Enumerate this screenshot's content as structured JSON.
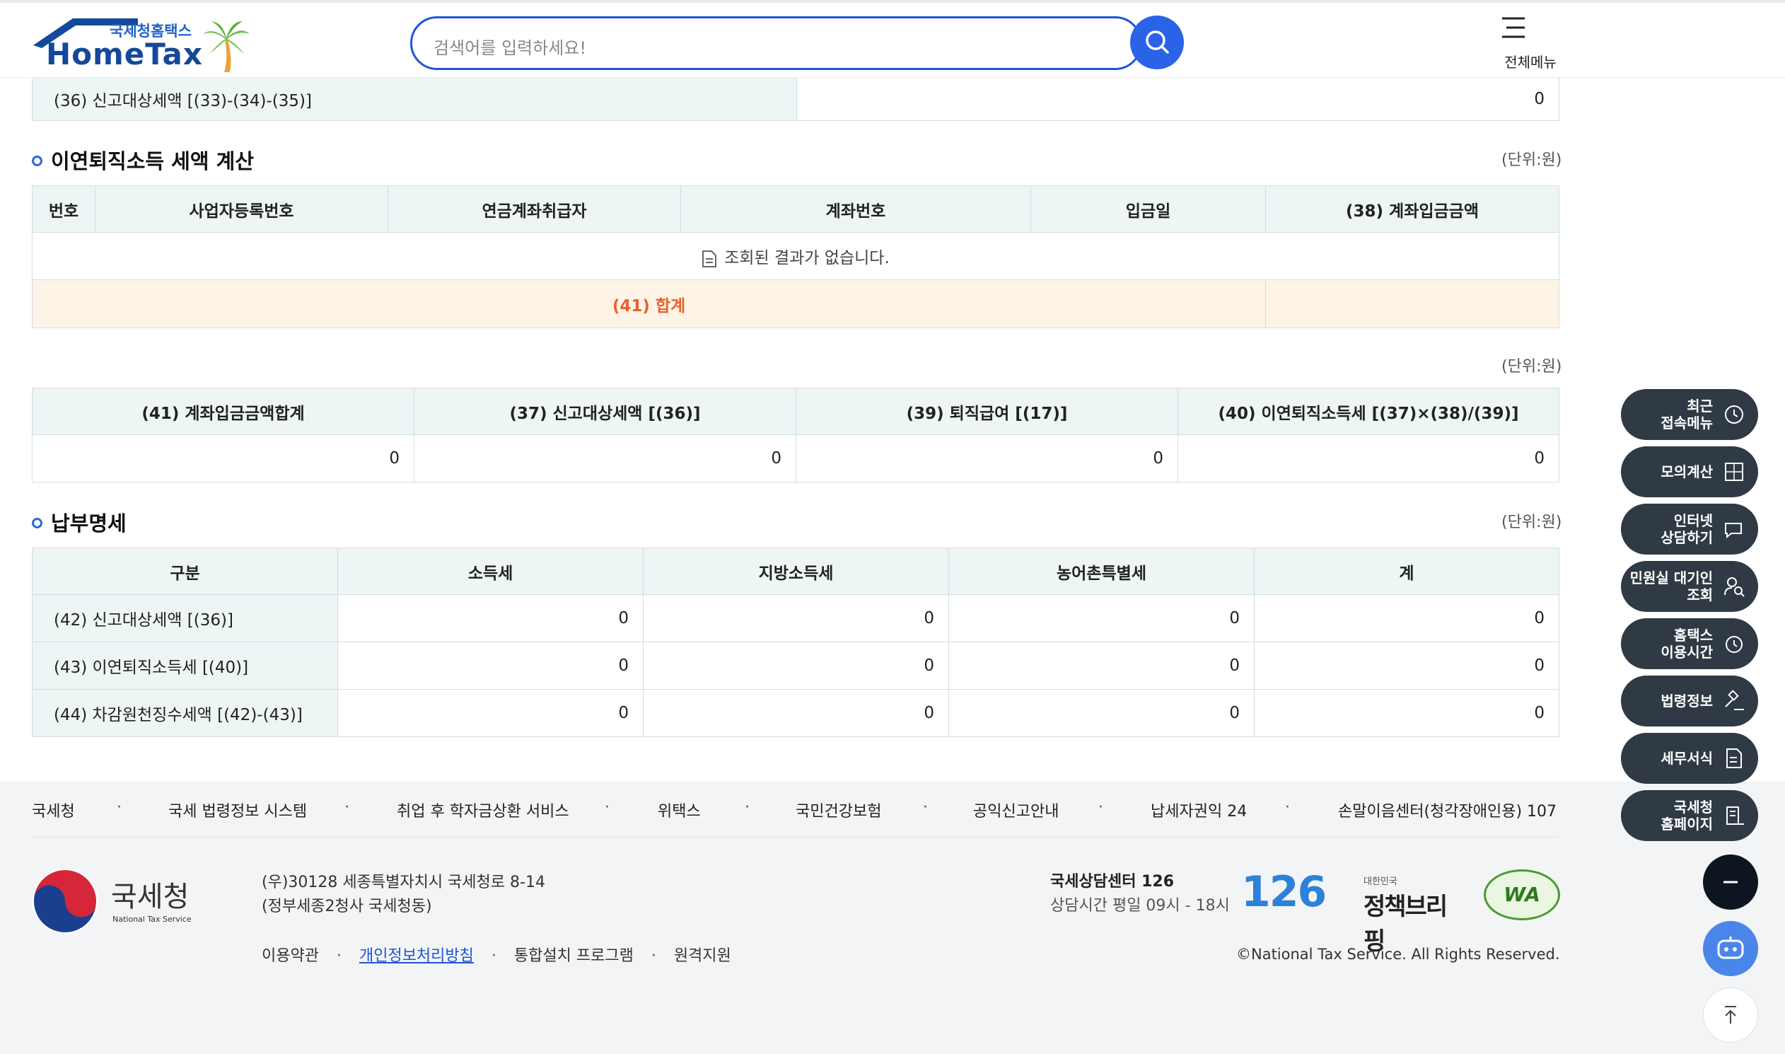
{
  "header": {
    "logo_sub": "국세청홈택스",
    "logo_main": "HomeTax",
    "search_placeholder": "검색어를 입력하세요!",
    "menu_label": "전체메뉴"
  },
  "top_row": {
    "label": "(36) 신고대상세액 [(33)-(34)-(35)]",
    "value": "0"
  },
  "section1": {
    "title": "이연퇴직소득 세액 계산",
    "unit": "(단위:원)",
    "columns": [
      "번호",
      "사업자등록번호",
      "연금계좌취급자",
      "계좌번호",
      "입금일",
      "(38) 계좌입금금액"
    ],
    "empty_message": "조회된 결과가 없습니다.",
    "total_label": "(41) 합계",
    "total_value": ""
  },
  "section2": {
    "unit": "(단위:원)",
    "columns": [
      "(41) 계좌입금금액합계",
      "(37) 신고대상세액 [(36)]",
      "(39) 퇴직급여 [(17)]",
      "(40) 이연퇴직소득세 [(37)×(38)/(39)]"
    ],
    "values": [
      "0",
      "0",
      "0",
      "0"
    ]
  },
  "section3": {
    "title": "납부명세",
    "unit": "(단위:원)",
    "columns": [
      "구분",
      "소득세",
      "지방소득세",
      "농어촌특별세",
      "계"
    ],
    "rows": [
      {
        "label": "(42) 신고대상세액 [(36)]",
        "values": [
          "0",
          "0",
          "0",
          "0"
        ]
      },
      {
        "label": "(43) 이연퇴직소득세 [(40)]",
        "values": [
          "0",
          "0",
          "0",
          "0"
        ]
      },
      {
        "label": "(44) 차감원천징수세액 [(42)-(43)]",
        "values": [
          "0",
          "0",
          "0",
          "0"
        ]
      }
    ]
  },
  "footer": {
    "links": [
      "국세청",
      "국세 법령정보 시스템",
      "취업 후 학자금상환 서비스",
      "위택스",
      "국민건강보험",
      "공익신고안내",
      "납세자권익 24",
      "손말이음센터(청각장애인용) 107"
    ],
    "org_name": "국세청",
    "org_name_en": "National Tax Service",
    "address1": "(우)30128 세종특별자치시 국세청로 8-14",
    "address2": "(정부세종2청사 국세청동)",
    "bottom_links": [
      "이용약관",
      "개인정보처리방침",
      "통합설치 프로그램",
      "원격지원"
    ],
    "center_name": "국세상담센터 126",
    "center_hours": "상담시간 평일 09시 - 18시",
    "badge_126": "126",
    "briefing_top": "대한민국",
    "briefing_main": "정책브리핑",
    "wa_badge": "WA",
    "copyright": "©National Tax Service. All Rights Reserved."
  },
  "quick_menu": [
    {
      "label": "최근\n접속메뉴",
      "icon": "clock-icon"
    },
    {
      "label": "모의계산",
      "icon": "calculator-icon"
    },
    {
      "label": "인터넷\n상담하기",
      "icon": "chat-icon"
    },
    {
      "label": "민원실 대기인\n조회",
      "icon": "person-search-icon"
    },
    {
      "label": "홈택스\n이용시간",
      "icon": "alarm-icon"
    },
    {
      "label": "법령정보",
      "icon": "gavel-icon"
    },
    {
      "label": "세무서식",
      "icon": "form-icon"
    },
    {
      "label": "국세청\n홈페이지",
      "icon": "building-icon"
    }
  ],
  "colors": {
    "accent": "#2a63e8",
    "total_bg": "#fdf3e7",
    "total_text": "#e8622c",
    "header_bg": "#eef5f5",
    "quick_bg": "#2f3a44"
  }
}
